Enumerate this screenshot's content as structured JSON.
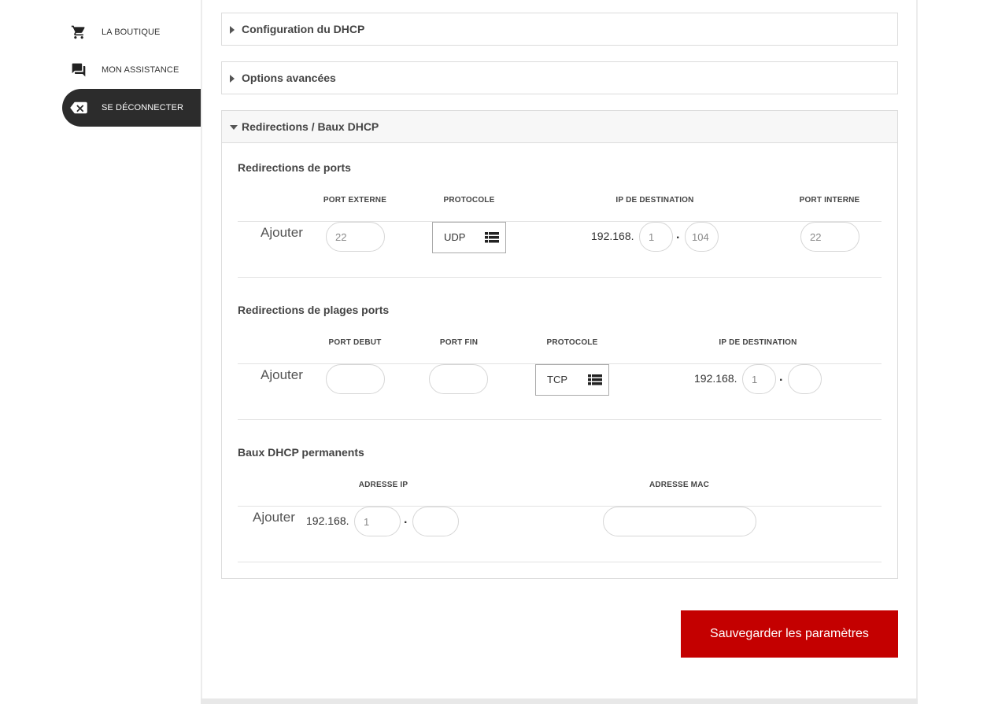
{
  "sidebar": {
    "items": [
      {
        "label": "LA BOUTIQUE",
        "icon": "cart-icon"
      },
      {
        "label": "MON ASSISTANCE",
        "icon": "forum-icon"
      },
      {
        "label": "SE DÉCONNECTER",
        "icon": "logout-icon",
        "active": true
      }
    ]
  },
  "accordions": {
    "dhcp_config": "Configuration du DHCP",
    "advanced": "Options avancées",
    "redirections": "Redirections / Baux DHCP"
  },
  "port_redirections": {
    "title": "Redirections de ports",
    "headers": {
      "external_port": "PORT EXTERNE",
      "protocol": "PROTOCOLE",
      "dest_ip": "IP DE DESTINATION",
      "internal_port": "PORT INTERNE"
    },
    "add_label": "Ajouter",
    "external_port_placeholder": "22",
    "protocol": "UDP",
    "ip_prefix": "192.168.",
    "ip_octet3_placeholder": "1",
    "ip_octet4_placeholder": "104",
    "internal_port_placeholder": "22"
  },
  "range_redirections": {
    "title": "Redirections de plages ports",
    "headers": {
      "port_start": "PORT DEBUT",
      "port_end": "PORT FIN",
      "protocol": "PROTOCOLE",
      "dest_ip": "IP DE DESTINATION"
    },
    "add_label": "Ajouter",
    "protocol": "TCP",
    "ip_prefix": "192.168.",
    "ip_octet3_placeholder": "1"
  },
  "dhcp_leases": {
    "title": "Baux DHCP permanents",
    "headers": {
      "ip": "ADRESSE IP",
      "mac": "ADRESSE MAC"
    },
    "add_label": "Ajouter",
    "ip_prefix": "192.168.",
    "ip_octet3_placeholder": "1"
  },
  "save_button": "Sauvegarder les paramètres",
  "colors": {
    "accent": "#c40000",
    "sidebar_active": "#2c2c2c"
  }
}
